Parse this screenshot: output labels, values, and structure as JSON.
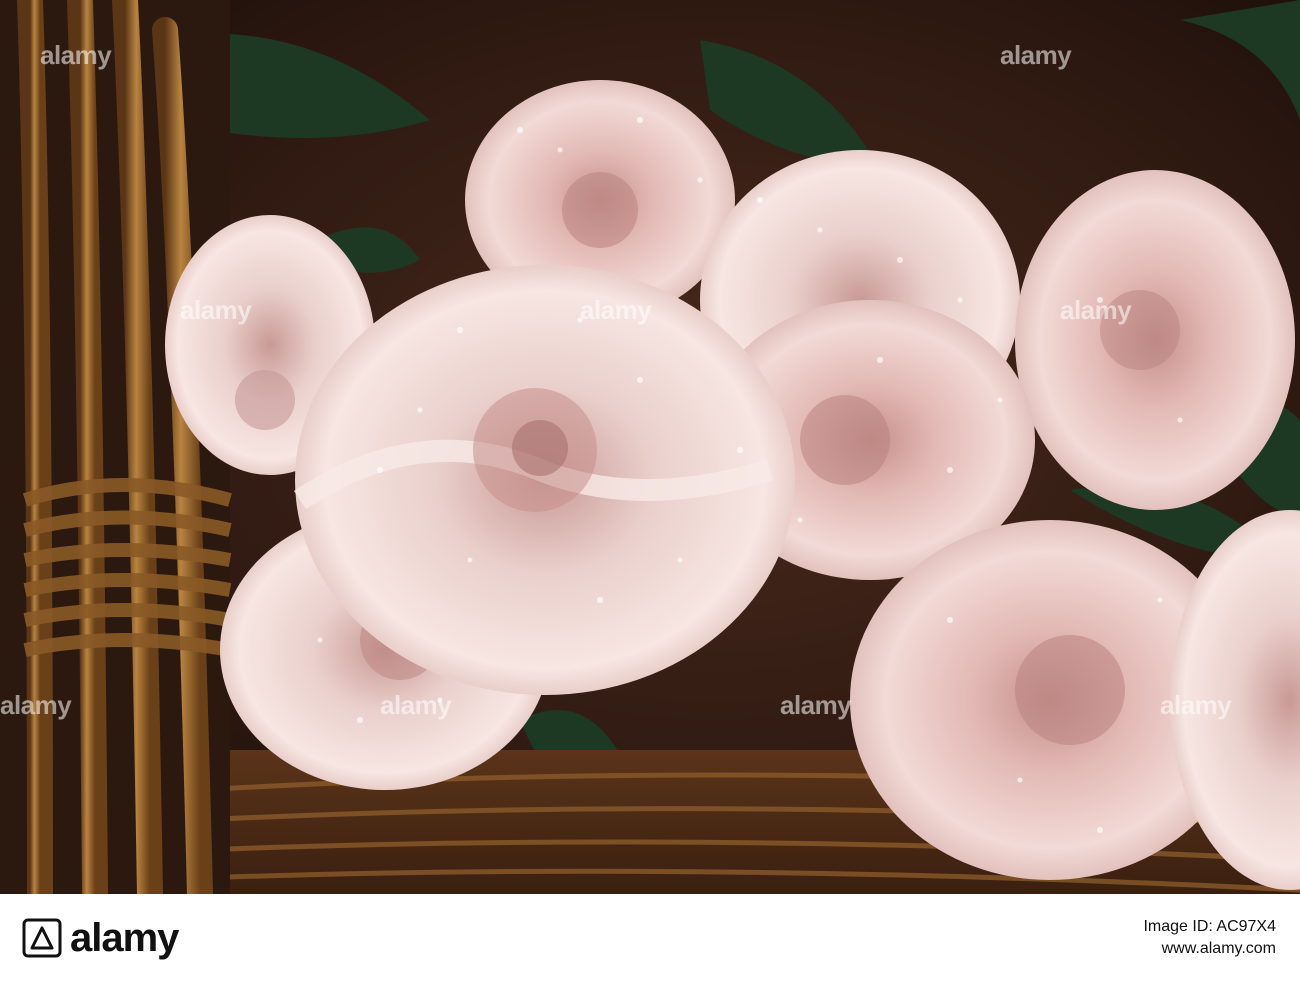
{
  "photo": {
    "subject": "pink roses with water droplets in a wicker basket",
    "palette": {
      "rose_light": "#f3dcd8",
      "rose_mid": "#e8bfbb",
      "rose_shadow": "#c99693",
      "leaf": "#1e3a24",
      "wicker": "#a8763a",
      "wicker_dark": "#5a3516",
      "background": "#3a1f16"
    }
  },
  "watermark": {
    "text": "alamy"
  },
  "footer": {
    "brand": "alamy",
    "image_id_label": "Image ID: AC97X4",
    "site": "www.alamy.com"
  }
}
